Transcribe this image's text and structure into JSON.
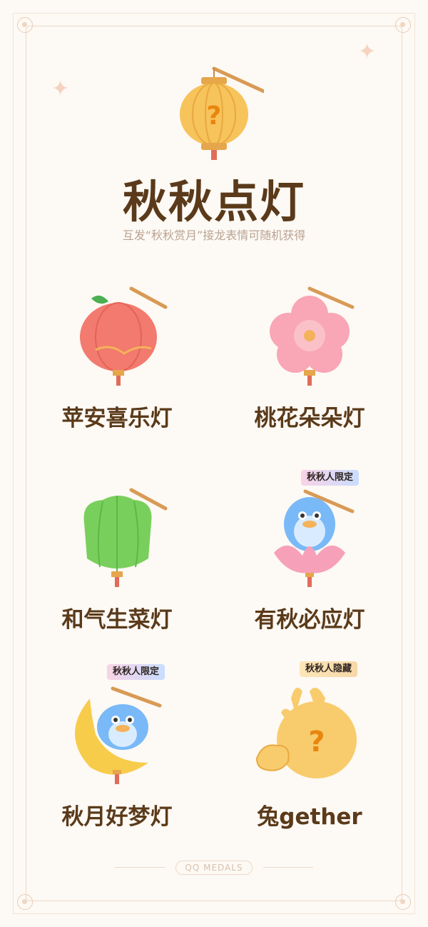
{
  "title": "秋秋点灯",
  "subtitle": "互发“秋秋赏月”接龙表情可随机获得",
  "footer": "QQ MEDALS",
  "hero_icon": "mystery-lantern-icon",
  "lanterns": [
    {
      "label": "苹安喜乐灯",
      "icon": "apple-lantern-icon"
    },
    {
      "label": "桃花朵朵灯",
      "icon": "peach-blossom-lantern-icon"
    },
    {
      "label": "和气生菜灯",
      "icon": "cabbage-lantern-icon"
    },
    {
      "label": "有秋必应灯",
      "icon": "penguin-lotus-lantern-icon",
      "tag": "秋秋人限定"
    },
    {
      "label": "秋月好梦灯",
      "icon": "penguin-moon-lantern-icon",
      "tag": "秋秋人限定"
    },
    {
      "label": "兔gether",
      "icon": "mystery-rabbit-lantern-icon",
      "tag": "秋秋人隐藏"
    }
  ],
  "colors": {
    "title": "#5a3a1a",
    "subtitle": "#b9a393",
    "background": "#fdf9f4"
  }
}
